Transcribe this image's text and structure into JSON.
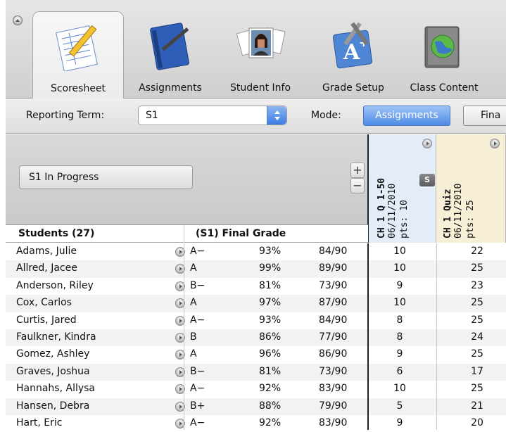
{
  "tabs": [
    {
      "label": "Scoresheet",
      "icon": "scoresheet-icon",
      "selected": true
    },
    {
      "label": "Assignments",
      "icon": "notebook-icon",
      "selected": false
    },
    {
      "label": "Student Info",
      "icon": "student-photos-icon",
      "selected": false
    },
    {
      "label": "Grade Setup",
      "icon": "grade-setup-icon",
      "selected": false
    },
    {
      "label": "Class Content",
      "icon": "globe-book-icon",
      "selected": false
    }
  ],
  "termbar": {
    "reporting_term_label": "Reporting Term:",
    "reporting_term_value": "S1",
    "mode_label": "Mode:",
    "mode_active": "Assignments",
    "mode_inactive": "Fina"
  },
  "header": {
    "progress_button": "S1 In Progress",
    "plus": "+",
    "minus": "−"
  },
  "assignments": [
    {
      "title": "CH 1 Q 1-50",
      "date": "06/11/2010",
      "pts": "pts: 10",
      "badge": "S"
    },
    {
      "title": "CH 1 Quiz",
      "date": "06/11/2010",
      "pts": "pts: 25"
    }
  ],
  "table": {
    "students_header": "Students (27)",
    "final_header": "(S1) Final Grade",
    "rows": [
      {
        "name": "Adams, Julie",
        "letter": "A−",
        "pct": "93%",
        "pts": "84/90",
        "s1": "10",
        "s2": "22"
      },
      {
        "name": "Allred, Jacee",
        "letter": "A",
        "pct": "99%",
        "pts": "89/90",
        "s1": "10",
        "s2": "25"
      },
      {
        "name": "Anderson, Riley",
        "letter": "B−",
        "pct": "81%",
        "pts": "73/90",
        "s1": "9",
        "s2": "23"
      },
      {
        "name": "Cox, Carlos",
        "letter": "A",
        "pct": "97%",
        "pts": "87/90",
        "s1": "10",
        "s2": "25"
      },
      {
        "name": "Curtis, Jared",
        "letter": "A−",
        "pct": "93%",
        "pts": "84/90",
        "s1": "8",
        "s2": "25"
      },
      {
        "name": "Faulkner, Kindra",
        "letter": "B",
        "pct": "86%",
        "pts": "77/90",
        "s1": "8",
        "s2": "24"
      },
      {
        "name": "Gomez, Ashley",
        "letter": "A",
        "pct": "96%",
        "pts": "86/90",
        "s1": "9",
        "s2": "25"
      },
      {
        "name": "Graves, Joshua",
        "letter": "B−",
        "pct": "81%",
        "pts": "73/90",
        "s1": "6",
        "s2": "17"
      },
      {
        "name": "Hannahs, Allysa",
        "letter": "A−",
        "pct": "92%",
        "pts": "83/90",
        "s1": "10",
        "s2": "25"
      },
      {
        "name": "Hansen, Debra",
        "letter": "B+",
        "pct": "88%",
        "pts": "79/90",
        "s1": "5",
        "s2": "21"
      },
      {
        "name": "Hart, Eric",
        "letter": "A−",
        "pct": "92%",
        "pts": "83/90",
        "s1": "9",
        "s2": "20"
      }
    ]
  }
}
